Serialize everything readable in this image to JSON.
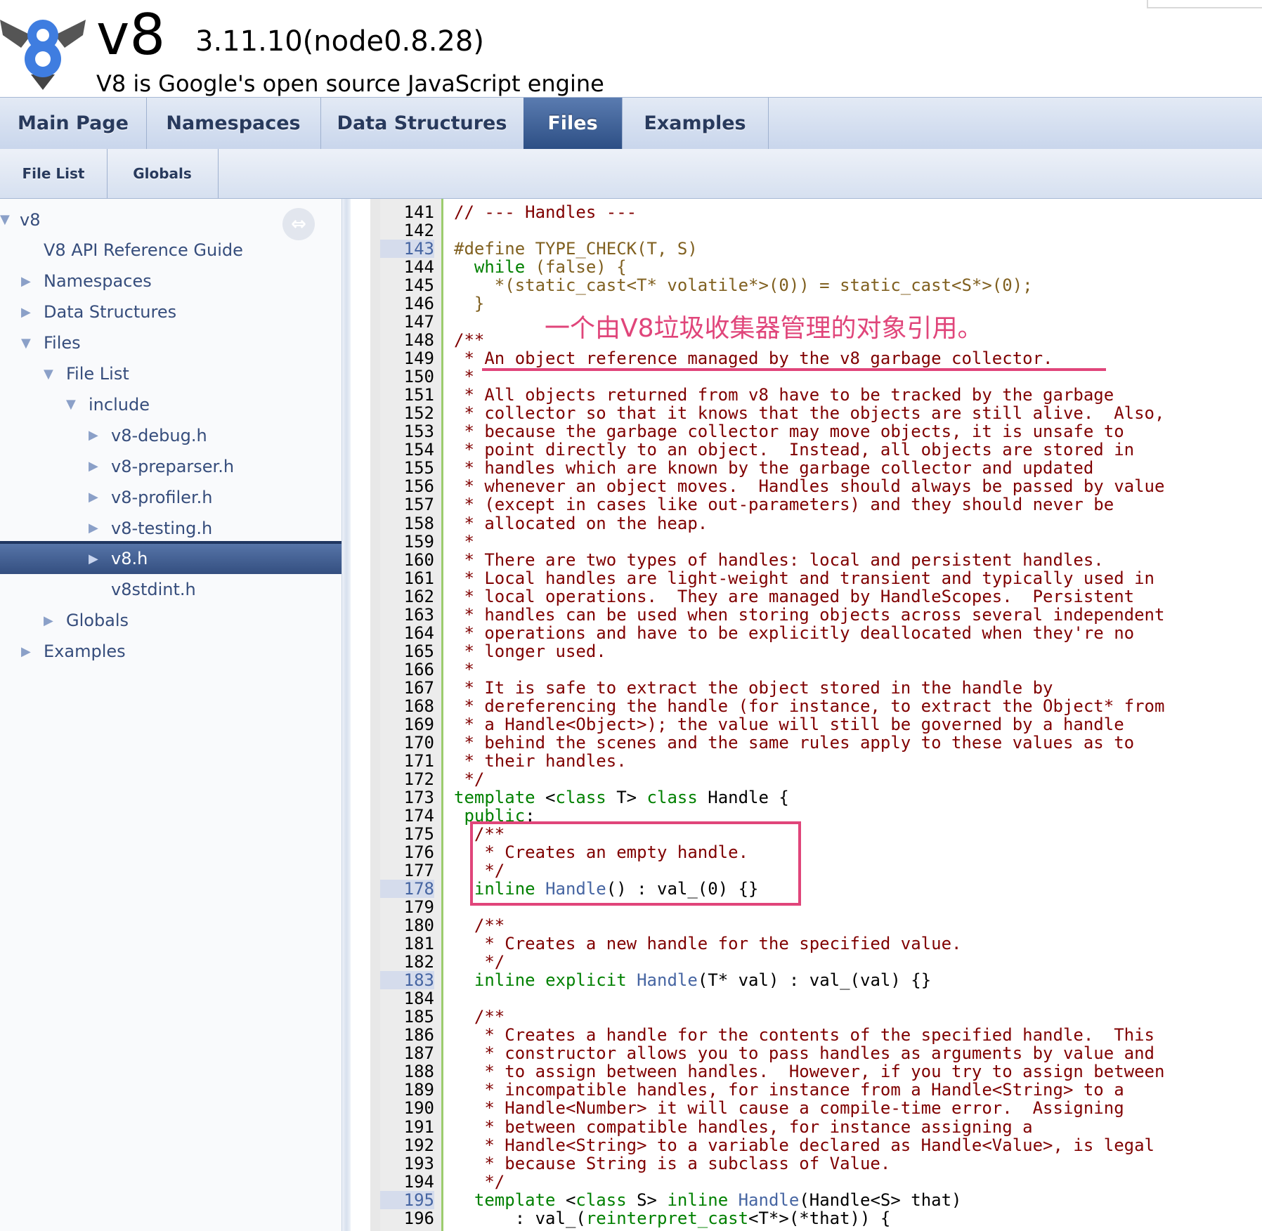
{
  "header": {
    "project_name": "v8",
    "project_number": "3.11.10(node0.8.28)",
    "project_brief": "V8 is Google's open source JavaScript engine"
  },
  "tabs": [
    {
      "label": "Main Page",
      "current": false
    },
    {
      "label": "Namespaces",
      "current": false
    },
    {
      "label": "Data Structures",
      "current": false
    },
    {
      "label": "Files",
      "current": true
    },
    {
      "label": "Examples",
      "current": false
    }
  ],
  "subtabs": [
    {
      "label": "File List"
    },
    {
      "label": "Globals"
    }
  ],
  "nav": [
    {
      "label": "v8",
      "arrow": "▼",
      "level": 0
    },
    {
      "label": "V8 API Reference Guide",
      "arrow": "",
      "level": 1
    },
    {
      "label": "Namespaces",
      "arrow": "▶",
      "level": 1
    },
    {
      "label": "Data Structures",
      "arrow": "▶",
      "level": 1
    },
    {
      "label": "Files",
      "arrow": "▼",
      "level": 1
    },
    {
      "label": "File List",
      "arrow": "▼",
      "level": 2
    },
    {
      "label": "include",
      "arrow": "▼",
      "level": 3
    },
    {
      "label": "v8-debug.h",
      "arrow": "▶",
      "level": 4
    },
    {
      "label": "v8-preparser.h",
      "arrow": "▶",
      "level": 4
    },
    {
      "label": "v8-profiler.h",
      "arrow": "▶",
      "level": 4
    },
    {
      "label": "v8-testing.h",
      "arrow": "▶",
      "level": 4
    },
    {
      "label": "v8.h",
      "arrow": "▶",
      "level": 4,
      "selected": true
    },
    {
      "label": "v8stdint.h",
      "arrow": "",
      "level": 4
    },
    {
      "label": "Globals",
      "arrow": "▶",
      "level": 2
    },
    {
      "label": "Examples",
      "arrow": "▶",
      "level": 1
    }
  ],
  "sync_icon": "sync-arrows-icon",
  "annotation": {
    "text": "一个由V8垃圾收集器管理的对象引用。",
    "color": "#e0457a"
  },
  "code_lines": [
    {
      "n": "141",
      "parts": [
        [
          "c-comment",
          "// --- Handles ---"
        ]
      ]
    },
    {
      "n": "142",
      "parts": []
    },
    {
      "n": "143",
      "anchor": true,
      "parts": [
        [
          "c-pre",
          "#define TYPE_CHECK(T, S)"
        ]
      ]
    },
    {
      "n": "144",
      "parts": [
        [
          "c-plain",
          "  "
        ],
        [
          "c-kw",
          "while"
        ],
        [
          "c-plain",
          " "
        ],
        [
          "c-pre",
          "(false) {"
        ]
      ]
    },
    {
      "n": "145",
      "parts": [
        [
          "c-pre",
          "    *(static_cast<T* volatile*>(0)) = static_cast<S*>(0);"
        ]
      ]
    },
    {
      "n": "146",
      "parts": [
        [
          "c-pre",
          "  }"
        ]
      ]
    },
    {
      "n": "147",
      "parts": []
    },
    {
      "n": "148",
      "parts": [
        [
          "c-comment",
          "/**"
        ]
      ]
    },
    {
      "n": "149",
      "parts": [
        [
          "c-comment",
          " * An object reference managed by the v8 garbage collector."
        ]
      ]
    },
    {
      "n": "150",
      "parts": [
        [
          "c-comment",
          " *"
        ]
      ]
    },
    {
      "n": "151",
      "parts": [
        [
          "c-comment",
          " * All objects returned from v8 have to be tracked by the garbage"
        ]
      ]
    },
    {
      "n": "152",
      "parts": [
        [
          "c-comment",
          " * collector so that it knows that the objects are still alive.  Also,"
        ]
      ]
    },
    {
      "n": "153",
      "parts": [
        [
          "c-comment",
          " * because the garbage collector may move objects, it is unsafe to"
        ]
      ]
    },
    {
      "n": "154",
      "parts": [
        [
          "c-comment",
          " * point directly to an object.  Instead, all objects are stored in"
        ]
      ]
    },
    {
      "n": "155",
      "parts": [
        [
          "c-comment",
          " * handles which are known by the garbage collector and updated"
        ]
      ]
    },
    {
      "n": "156",
      "parts": [
        [
          "c-comment",
          " * whenever an object moves.  Handles should always be passed by value"
        ]
      ]
    },
    {
      "n": "157",
      "parts": [
        [
          "c-comment",
          " * (except in cases like out-parameters) and they should never be"
        ]
      ]
    },
    {
      "n": "158",
      "parts": [
        [
          "c-comment",
          " * allocated on the heap."
        ]
      ]
    },
    {
      "n": "159",
      "parts": [
        [
          "c-comment",
          " *"
        ]
      ]
    },
    {
      "n": "160",
      "parts": [
        [
          "c-comment",
          " * There are two types of handles: local and persistent handles."
        ]
      ]
    },
    {
      "n": "161",
      "parts": [
        [
          "c-comment",
          " * Local handles are light-weight and transient and typically used in"
        ]
      ]
    },
    {
      "n": "162",
      "parts": [
        [
          "c-comment",
          " * local operations.  They are managed by HandleScopes.  Persistent"
        ]
      ]
    },
    {
      "n": "163",
      "parts": [
        [
          "c-comment",
          " * handles can be used when storing objects across several independent"
        ]
      ]
    },
    {
      "n": "164",
      "parts": [
        [
          "c-comment",
          " * operations and have to be explicitly deallocated when they're no"
        ]
      ]
    },
    {
      "n": "165",
      "parts": [
        [
          "c-comment",
          " * longer used."
        ]
      ]
    },
    {
      "n": "166",
      "parts": [
        [
          "c-comment",
          " *"
        ]
      ]
    },
    {
      "n": "167",
      "parts": [
        [
          "c-comment",
          " * It is safe to extract the object stored in the handle by"
        ]
      ]
    },
    {
      "n": "168",
      "parts": [
        [
          "c-comment",
          " * dereferencing the handle (for instance, to extract the Object* from"
        ]
      ]
    },
    {
      "n": "169",
      "parts": [
        [
          "c-comment",
          " * a Handle<Object>); the value will still be governed by a handle"
        ]
      ]
    },
    {
      "n": "170",
      "parts": [
        [
          "c-comment",
          " * behind the scenes and the same rules apply to these values as to"
        ]
      ]
    },
    {
      "n": "171",
      "parts": [
        [
          "c-comment",
          " * their handles."
        ]
      ]
    },
    {
      "n": "172",
      "parts": [
        [
          "c-comment",
          " */"
        ]
      ]
    },
    {
      "n": "173",
      "parts": [
        [
          "c-kw",
          "template"
        ],
        [
          "c-plain",
          " <"
        ],
        [
          "c-kw",
          "class"
        ],
        [
          "c-plain",
          " T> "
        ],
        [
          "c-kw",
          "class"
        ],
        [
          "c-plain",
          " Handle {"
        ]
      ]
    },
    {
      "n": "174",
      "parts": [
        [
          "c-plain",
          " "
        ],
        [
          "c-kw",
          "public"
        ],
        [
          "c-plain",
          ":"
        ]
      ]
    },
    {
      "n": "175",
      "parts": [
        [
          "c-comment",
          "  /**"
        ]
      ]
    },
    {
      "n": "176",
      "parts": [
        [
          "c-comment",
          "   * Creates an empty handle."
        ]
      ]
    },
    {
      "n": "177",
      "parts": [
        [
          "c-comment",
          "   */"
        ]
      ]
    },
    {
      "n": "178",
      "anchor": true,
      "parts": [
        [
          "c-plain",
          "  "
        ],
        [
          "c-kw",
          "inline"
        ],
        [
          "c-plain",
          " "
        ],
        [
          "c-fn",
          "Handle"
        ],
        [
          "c-plain",
          "() : val_(0) {}"
        ]
      ]
    },
    {
      "n": "179",
      "parts": []
    },
    {
      "n": "180",
      "parts": [
        [
          "c-comment",
          "  /**"
        ]
      ]
    },
    {
      "n": "181",
      "parts": [
        [
          "c-comment",
          "   * Creates a new handle for the specified value."
        ]
      ]
    },
    {
      "n": "182",
      "parts": [
        [
          "c-comment",
          "   */"
        ]
      ]
    },
    {
      "n": "183",
      "anchor": true,
      "parts": [
        [
          "c-plain",
          "  "
        ],
        [
          "c-kw",
          "inline"
        ],
        [
          "c-plain",
          " "
        ],
        [
          "c-kw",
          "explicit"
        ],
        [
          "c-plain",
          " "
        ],
        [
          "c-fn",
          "Handle"
        ],
        [
          "c-plain",
          "(T* val) : val_(val) {}"
        ]
      ]
    },
    {
      "n": "184",
      "parts": []
    },
    {
      "n": "185",
      "parts": [
        [
          "c-comment",
          "  /**"
        ]
      ]
    },
    {
      "n": "186",
      "parts": [
        [
          "c-comment",
          "   * Creates a handle for the contents of the specified handle.  This"
        ]
      ]
    },
    {
      "n": "187",
      "parts": [
        [
          "c-comment",
          "   * constructor allows you to pass handles as arguments by value and"
        ]
      ]
    },
    {
      "n": "188",
      "parts": [
        [
          "c-comment",
          "   * to assign between handles.  However, if you try to assign between"
        ]
      ]
    },
    {
      "n": "189",
      "parts": [
        [
          "c-comment",
          "   * incompatible handles, for instance from a Handle<String> to a"
        ]
      ]
    },
    {
      "n": "190",
      "parts": [
        [
          "c-comment",
          "   * Handle<Number> it will cause a compile-time error.  Assigning"
        ]
      ]
    },
    {
      "n": "191",
      "parts": [
        [
          "c-comment",
          "   * between compatible handles, for instance assigning a"
        ]
      ]
    },
    {
      "n": "192",
      "parts": [
        [
          "c-comment",
          "   * Handle<String> to a variable declared as Handle<Value>, is legal"
        ]
      ]
    },
    {
      "n": "193",
      "parts": [
        [
          "c-comment",
          "   * because String is a subclass of Value."
        ]
      ]
    },
    {
      "n": "194",
      "parts": [
        [
          "c-comment",
          "   */"
        ]
      ]
    },
    {
      "n": "195",
      "anchor": true,
      "parts": [
        [
          "c-plain",
          "  "
        ],
        [
          "c-kw",
          "template"
        ],
        [
          "c-plain",
          " <"
        ],
        [
          "c-kw",
          "class"
        ],
        [
          "c-plain",
          " S> "
        ],
        [
          "c-kw",
          "inline"
        ],
        [
          "c-plain",
          " "
        ],
        [
          "c-fn",
          "Handle"
        ],
        [
          "c-plain",
          "(Handle<S> that)"
        ]
      ]
    },
    {
      "n": "196",
      "parts": [
        [
          "c-plain",
          "      : val_("
        ],
        [
          "c-kw",
          "reinterpret_cast"
        ],
        [
          "c-plain",
          "<T*>(*that)) {"
        ]
      ]
    }
  ]
}
